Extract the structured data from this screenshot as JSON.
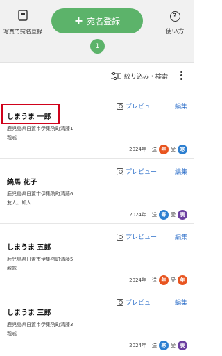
{
  "header": {
    "photo_register_label": "写真で宛名登録",
    "add_button_label": "宛名登録",
    "count_badge": "1",
    "help_label": "使い方",
    "help_symbol": "?"
  },
  "toolbar": {
    "filter_label": "絞り込み・検索"
  },
  "cards": [
    {
      "preview_label": "プレビュー",
      "edit_label": "編集",
      "name": "しまうま 一郎",
      "address": "鹿児島県日置市伊集院町清藤1",
      "relation": "親戚",
      "year": "2024年",
      "sent_label": "送",
      "sent_status": "年",
      "sent_color": "#e8541f",
      "received_label": "受",
      "received_status": "寒",
      "received_color": "#2d7fd0"
    },
    {
      "preview_label": "プレビュー",
      "edit_label": "編集",
      "name": "縞馬 花子",
      "address": "鹿児島県日置市伊集院町清藤6",
      "relation": "友人、知人",
      "year": "2024年",
      "sent_label": "送",
      "sent_status": "寒",
      "sent_color": "#2d7fd0",
      "received_label": "受",
      "received_status": "喪",
      "received_color": "#6b3fa0"
    },
    {
      "preview_label": "プレビュー",
      "edit_label": "編集",
      "name": "しまうま 五郎",
      "address": "鹿児島県日置市伊集院町清藤5",
      "relation": "親戚",
      "year": "2024年",
      "sent_label": "送",
      "sent_status": "年",
      "sent_color": "#e8541f",
      "received_label": "受",
      "received_status": "年",
      "received_color": "#e8541f"
    },
    {
      "preview_label": "プレビュー",
      "edit_label": "編集",
      "name": "しまうま 三郎",
      "address": "鹿児島県日置市伊集院町清藤3",
      "relation": "親戚",
      "year": "2024年",
      "sent_label": "送",
      "sent_status": "寒",
      "sent_color": "#2d7fd0",
      "received_label": "受",
      "received_status": "喪",
      "received_color": "#6b3fa0"
    }
  ]
}
